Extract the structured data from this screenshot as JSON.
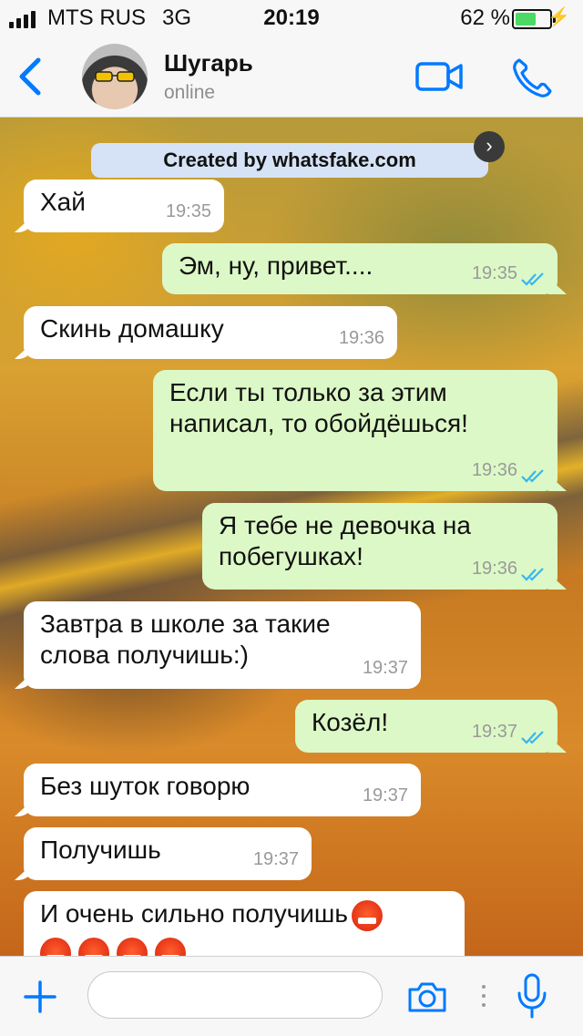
{
  "status_bar": {
    "carrier": "MTS RUS",
    "network": "3G",
    "time": "20:19",
    "battery_text": "62 %",
    "battery_level": 0.62
  },
  "header": {
    "contact_name": "Шугарь",
    "contact_status": "online",
    "icons": [
      "back-chevron-icon",
      "avatar",
      "video-call-icon",
      "phone-icon"
    ]
  },
  "watermark": "Created by whatsfake.com",
  "messages": [
    {
      "dir": "in",
      "text": "Хай",
      "time": "19:35"
    },
    {
      "dir": "out",
      "text": "Эм, ну, привет....",
      "time": "19:35"
    },
    {
      "dir": "in",
      "text": "Скинь домашку",
      "time": "19:36"
    },
    {
      "dir": "out",
      "text": "Если ты только за этим написал, то обойдёшься!",
      "time": "19:36"
    },
    {
      "dir": "out",
      "text": "Я тебе не девочка на побегушках!",
      "time": "19:36"
    },
    {
      "dir": "in",
      "text": "Завтра в школе за такие слова получишь:)",
      "time": "19:37"
    },
    {
      "dir": "out",
      "text": "Козёл!",
      "time": "19:37"
    },
    {
      "dir": "in",
      "text": "Без шуток говорю",
      "time": "19:37"
    },
    {
      "dir": "in",
      "text": "Получишь",
      "time": "19:37"
    },
    {
      "dir": "in",
      "text": "И очень сильно получишь",
      "time": ""
    }
  ],
  "input_bar": {
    "placeholder": "",
    "icons": [
      "plus-icon",
      "camera-icon",
      "microphone-icon"
    ]
  },
  "colors": {
    "accent": "#007aff",
    "incoming_bubble": "#ffffff",
    "outgoing_bubble": "#dcf8c6",
    "read_ticks": "#34b7f1"
  }
}
